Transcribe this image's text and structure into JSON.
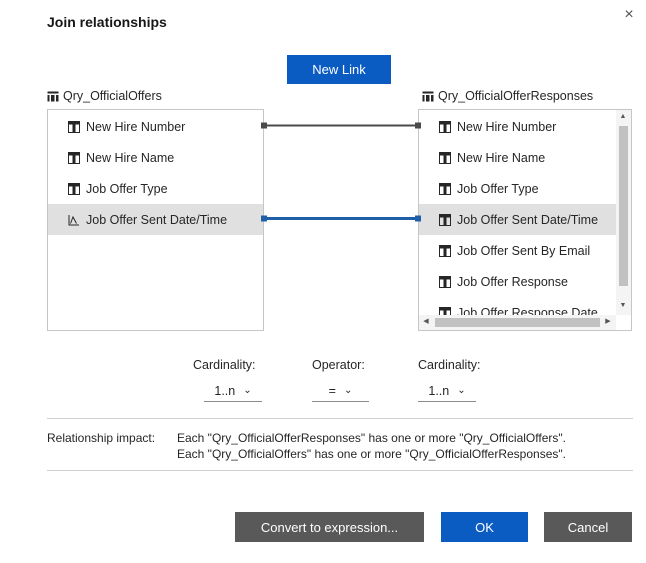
{
  "dialog": {
    "title": "Join relationships",
    "close_glyph": "×"
  },
  "new_link_label": "New Link",
  "left_table": {
    "name": "Qry_OfficialOffers",
    "rows": [
      {
        "label": "New Hire Number",
        "icon": "column-icon",
        "selected": false
      },
      {
        "label": "New Hire Name",
        "icon": "column-icon",
        "selected": false
      },
      {
        "label": "Job Offer Type",
        "icon": "column-icon",
        "selected": false
      },
      {
        "label": "Job Offer Sent Date/Time",
        "icon": "date-measure-icon",
        "selected": true
      }
    ]
  },
  "right_table": {
    "name": "Qry_OfficialOfferResponses",
    "rows": [
      {
        "label": "New Hire Number",
        "icon": "column-icon",
        "selected": false
      },
      {
        "label": "New Hire Name",
        "icon": "column-icon",
        "selected": false
      },
      {
        "label": "Job Offer Type",
        "icon": "column-icon",
        "selected": false
      },
      {
        "label": "Job Offer Sent Date/Time",
        "icon": "column-icon",
        "selected": true
      },
      {
        "label": "Job Offer Sent By Email",
        "icon": "column-icon",
        "selected": false
      },
      {
        "label": "Job Offer Response",
        "icon": "column-icon",
        "selected": false
      },
      {
        "label": "Job Offer Response Date",
        "icon": "column-icon",
        "selected": false
      }
    ]
  },
  "links": [
    {
      "from": "New Hire Number",
      "to": "New Hire Number",
      "active": false,
      "color": "#4a4a4a"
    },
    {
      "from": "Job Offer Sent Date/Time",
      "to": "Job Offer Sent Date/Time",
      "active": true,
      "color": "#1f5fa8"
    }
  ],
  "join_settings": {
    "left_cardinality": {
      "label": "Cardinality:",
      "value": "1..n"
    },
    "operator": {
      "label": "Operator:",
      "value": "="
    },
    "right_cardinality": {
      "label": "Cardinality:",
      "value": "1..n"
    }
  },
  "impact": {
    "label": "Relationship impact:",
    "line1": "Each \"Qry_OfficialOfferResponses\" has one or more \"Qry_OfficialOffers\".",
    "line2": "Each \"Qry_OfficialOffers\" has one or more \"Qry_OfficialOfferResponses\"."
  },
  "buttons": {
    "convert": "Convert to expression...",
    "ok": "OK",
    "cancel": "Cancel"
  },
  "colors": {
    "primary": "#0a5cc2",
    "secondary": "#595959",
    "selected_row": "#e0e0e0"
  }
}
